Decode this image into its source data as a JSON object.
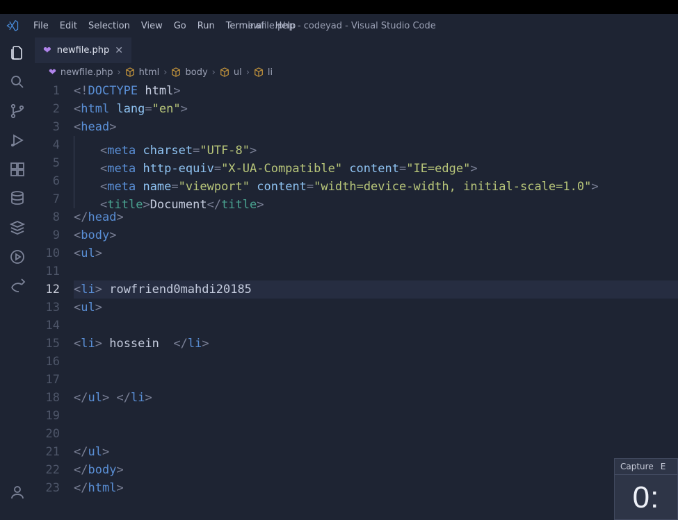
{
  "window": {
    "title": "newfile.php - codeyad - Visual Studio Code"
  },
  "menu": {
    "items": [
      "File",
      "Edit",
      "Selection",
      "View",
      "Go",
      "Run",
      "Terminal",
      "Help"
    ]
  },
  "activitybar": {
    "icons": [
      {
        "name": "files-icon",
        "active": true
      },
      {
        "name": "search-icon",
        "active": false
      },
      {
        "name": "git-branch-icon",
        "active": false
      },
      {
        "name": "debug-run-icon",
        "active": false
      },
      {
        "name": "extensions-icon",
        "active": false
      },
      {
        "name": "database-icon",
        "active": false
      },
      {
        "name": "stack-icon",
        "active": false
      },
      {
        "name": "arrow-circle-icon",
        "active": false
      },
      {
        "name": "share-icon",
        "active": false
      }
    ],
    "bottom": [
      {
        "name": "account-icon"
      }
    ]
  },
  "tab": {
    "filename": "newfile.php"
  },
  "breadcrumbs": {
    "segments": [
      {
        "text": "newfile.php",
        "icon": "php"
      },
      {
        "text": "html",
        "icon": "cube"
      },
      {
        "text": "body",
        "icon": "cube"
      },
      {
        "text": "ul",
        "icon": "cube"
      },
      {
        "text": "li",
        "icon": "cube"
      }
    ]
  },
  "editor": {
    "current_line": 12,
    "lines": [
      {
        "n": 1,
        "i": 0,
        "tokens": [
          [
            "<",
            "punc"
          ],
          [
            "!",
            "punc"
          ],
          [
            "DOCTYPE",
            "doctype"
          ],
          [
            " ",
            "punc"
          ],
          [
            "html",
            "text"
          ],
          [
            ">",
            "punc"
          ]
        ]
      },
      {
        "n": 2,
        "i": 0,
        "tokens": [
          [
            "<",
            "punc"
          ],
          [
            "html",
            "tag"
          ],
          [
            " ",
            "punc"
          ],
          [
            "lang",
            "attr"
          ],
          [
            "=",
            "punc"
          ],
          [
            "\"en\"",
            "str"
          ],
          [
            ">",
            "punc"
          ]
        ]
      },
      {
        "n": 3,
        "i": 0,
        "tokens": [
          [
            "<",
            "punc"
          ],
          [
            "head",
            "tag"
          ],
          [
            ">",
            "punc"
          ]
        ]
      },
      {
        "n": 4,
        "i": 1,
        "tokens": [
          [
            "<",
            "punc"
          ],
          [
            "meta",
            "tag"
          ],
          [
            " ",
            "punc"
          ],
          [
            "charset",
            "attr"
          ],
          [
            "=",
            "punc"
          ],
          [
            "\"UTF-8\"",
            "str"
          ],
          [
            ">",
            "punc"
          ]
        ]
      },
      {
        "n": 5,
        "i": 1,
        "tokens": [
          [
            "<",
            "punc"
          ],
          [
            "meta",
            "tag"
          ],
          [
            " ",
            "punc"
          ],
          [
            "http-equiv",
            "attr"
          ],
          [
            "=",
            "punc"
          ],
          [
            "\"X-UA-Compatible\"",
            "str"
          ],
          [
            " ",
            "punc"
          ],
          [
            "content",
            "attr"
          ],
          [
            "=",
            "punc"
          ],
          [
            "\"IE=edge\"",
            "str"
          ],
          [
            ">",
            "punc"
          ]
        ]
      },
      {
        "n": 6,
        "i": 1,
        "tokens": [
          [
            "<",
            "punc"
          ],
          [
            "meta",
            "tag"
          ],
          [
            " ",
            "punc"
          ],
          [
            "name",
            "attr"
          ],
          [
            "=",
            "punc"
          ],
          [
            "\"viewport\"",
            "str"
          ],
          [
            " ",
            "punc"
          ],
          [
            "content",
            "attr"
          ],
          [
            "=",
            "punc"
          ],
          [
            "\"width=device-width, initial-scale=1.0\"",
            "str"
          ],
          [
            ">",
            "punc"
          ]
        ]
      },
      {
        "n": 7,
        "i": 1,
        "tokens": [
          [
            "<",
            "punc"
          ],
          [
            "title",
            "title"
          ],
          [
            ">",
            "punc"
          ],
          [
            "Document",
            "text"
          ],
          [
            "</",
            "punc"
          ],
          [
            "title",
            "title"
          ],
          [
            ">",
            "punc"
          ]
        ]
      },
      {
        "n": 8,
        "i": 0,
        "tokens": [
          [
            "</",
            "punc"
          ],
          [
            "head",
            "tag"
          ],
          [
            ">",
            "punc"
          ]
        ]
      },
      {
        "n": 9,
        "i": 0,
        "tokens": [
          [
            "<",
            "punc"
          ],
          [
            "body",
            "tag"
          ],
          [
            ">",
            "punc"
          ]
        ]
      },
      {
        "n": 10,
        "i": 0,
        "tokens": [
          [
            "<",
            "punc"
          ],
          [
            "ul",
            "tag"
          ],
          [
            ">",
            "punc"
          ]
        ]
      },
      {
        "n": 11,
        "i": 0,
        "tokens": []
      },
      {
        "n": 12,
        "i": 0,
        "tokens": [
          [
            "<",
            "punc"
          ],
          [
            "li",
            "tag"
          ],
          [
            ">",
            "punc"
          ],
          [
            " rowfriend0mahdi20185",
            "text"
          ]
        ]
      },
      {
        "n": 13,
        "i": 0,
        "tokens": [
          [
            "<",
            "punc"
          ],
          [
            "ul",
            "tag"
          ],
          [
            ">",
            "punc"
          ]
        ]
      },
      {
        "n": 14,
        "i": 0,
        "tokens": []
      },
      {
        "n": 15,
        "i": 0,
        "tokens": [
          [
            "<",
            "punc"
          ],
          [
            "li",
            "tag"
          ],
          [
            ">",
            "punc"
          ],
          [
            " hossein  ",
            "text"
          ],
          [
            "</",
            "punc"
          ],
          [
            "li",
            "tag"
          ],
          [
            ">",
            "punc"
          ]
        ]
      },
      {
        "n": 16,
        "i": 0,
        "tokens": []
      },
      {
        "n": 17,
        "i": 0,
        "tokens": []
      },
      {
        "n": 18,
        "i": 0,
        "tokens": [
          [
            "</",
            "punc"
          ],
          [
            "ul",
            "tag"
          ],
          [
            ">",
            "punc"
          ],
          [
            " ",
            "text"
          ],
          [
            "</",
            "punc"
          ],
          [
            "li",
            "tag"
          ],
          [
            ">",
            "punc"
          ]
        ]
      },
      {
        "n": 19,
        "i": 0,
        "tokens": []
      },
      {
        "n": 20,
        "i": 0,
        "tokens": []
      },
      {
        "n": 21,
        "i": 0,
        "tokens": [
          [
            "</",
            "punc"
          ],
          [
            "ul",
            "tag"
          ],
          [
            ">",
            "punc"
          ]
        ]
      },
      {
        "n": 22,
        "i": 0,
        "tokens": [
          [
            "</",
            "punc"
          ],
          [
            "body",
            "tag"
          ],
          [
            ">",
            "punc"
          ]
        ]
      },
      {
        "n": 23,
        "i": 0,
        "tokens": [
          [
            "</",
            "punc"
          ],
          [
            "html",
            "tag"
          ],
          [
            ">",
            "punc"
          ]
        ]
      }
    ]
  },
  "overlay": {
    "buttons": [
      "Capture",
      "E"
    ],
    "time": "0:"
  }
}
